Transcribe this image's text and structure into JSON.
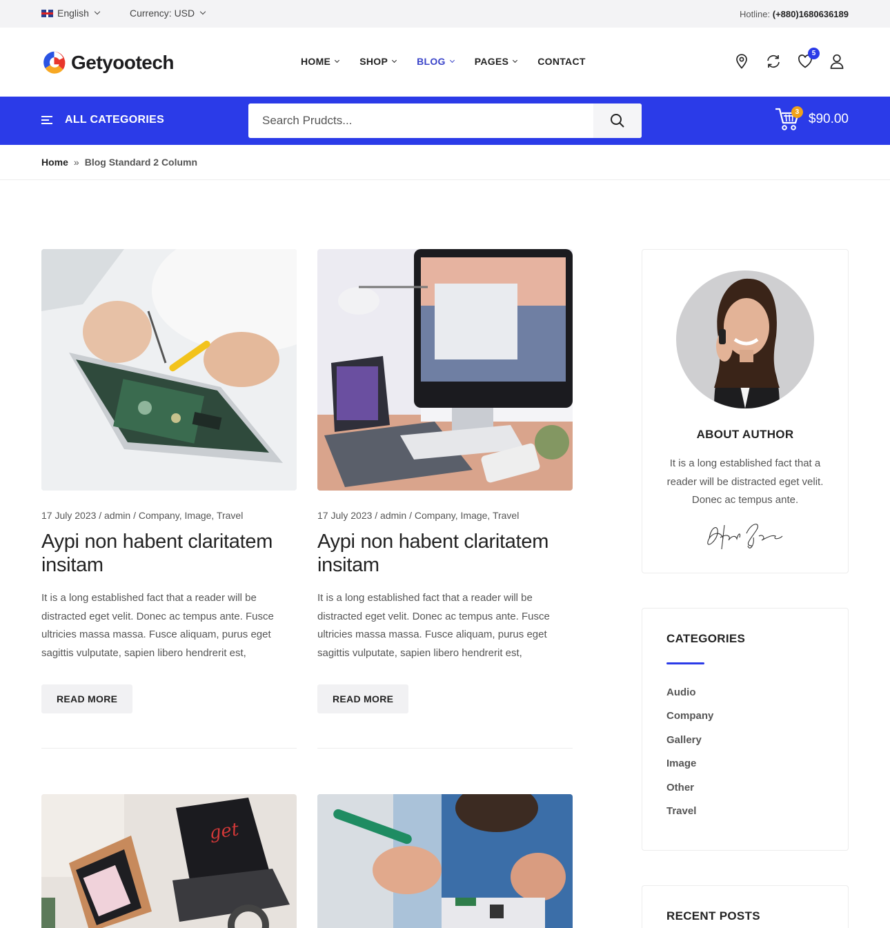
{
  "topbar": {
    "language": "English",
    "currency": "Currency: USD",
    "hotline_label": "Hotline:",
    "hotline_number": "(+880)1680636189"
  },
  "header": {
    "logo_text": "Getyootech",
    "nav": [
      {
        "label": "HOME",
        "dropdown": true
      },
      {
        "label": "SHOP",
        "dropdown": true
      },
      {
        "label": "BLOG",
        "dropdown": true,
        "active": true
      },
      {
        "label": "PAGES",
        "dropdown": true
      },
      {
        "label": "CONTACT",
        "dropdown": false
      }
    ],
    "wishlist_count": "5",
    "icons": [
      "location-pin-icon",
      "compare-refresh-icon",
      "wishlist-heart-icon",
      "user-account-icon"
    ]
  },
  "catbar": {
    "all_categories": "ALL CATEGORIES",
    "search_placeholder": "Search Prudcts...",
    "cart_count": "3",
    "cart_total": "$90.00"
  },
  "breadcrumb": {
    "home": "Home",
    "separator": "»",
    "current": "Blog Standard 2 Column"
  },
  "posts": [
    {
      "meta": "17 July 2023 / admin / Company, Image, Travel",
      "title": "Aypi non habent claritatem insitam",
      "excerpt": "It is a long established fact that a reader will be distracted eget velit. Donec ac tempus ante. Fusce ultricies massa massa. Fusce aliquam, purus eget sagittis vulputate, sapien libero hendrerit est,",
      "button": "READ MORE"
    },
    {
      "meta": "17 July 2023 / admin / Company, Image, Travel",
      "title": "Aypi non habent claritatem insitam",
      "excerpt": "It is a long established fact that a reader will be distracted eget velit. Donec ac tempus ante. Fusce ultricies massa massa. Fusce aliquam, purus eget sagittis vulputate, sapien libero hendrerit est,",
      "button": "READ MORE"
    }
  ],
  "sidebar": {
    "author": {
      "title": "ABOUT AUTHOR",
      "bio": "It is a long established fact that a reader will be distracted eget velit. Donec ac tempus ante.",
      "signature": "Author Signature"
    },
    "categories": {
      "title": "CATEGORIES",
      "items": [
        "Audio",
        "Company",
        "Gallery",
        "Image",
        "Other",
        "Travel"
      ]
    },
    "recent_posts": {
      "title": "RECENT POSTS"
    }
  },
  "colors": {
    "accent_blue": "#2b3be8",
    "nav_active": "#3a44c9",
    "badge_orange": "#f0a21a",
    "logo_red": "#e8372c",
    "logo_orange": "#f7a823",
    "logo_blue": "#2b54e3"
  }
}
